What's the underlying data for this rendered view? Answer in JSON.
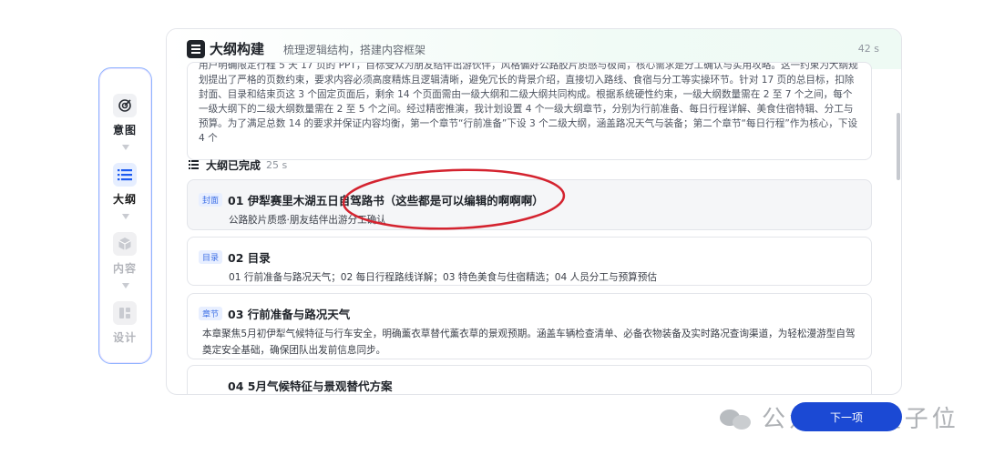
{
  "steps": [
    {
      "label": "意图",
      "icon": "target-icon",
      "state": "done"
    },
    {
      "label": "大纲",
      "icon": "list-icon",
      "state": "active"
    },
    {
      "label": "内容",
      "icon": "cube-icon",
      "state": "pending"
    },
    {
      "label": "设计",
      "icon": "design-icon",
      "state": "pending"
    }
  ],
  "header": {
    "title": "大纲构建",
    "subtitle": "梳理逻辑结构，搭建内容框架",
    "time": "42 s"
  },
  "reasoning": {
    "text": "用户明确限定行程 5 天 17 页的 PPT，目标受众为朋友结伴出游伙伴，风格偏好公路胶片质感与极简，核心需求是分工确认与实用攻略。这一约束为大纲规划提出了严格的页数约束，要求内容必须高度精炼且逻辑清晰，避免冗长的背景介绍，直接切入路线、食宿与分工等实操环节。针对 17 页的总目标，扣除封面、目录和结束页这 3 个固定页面后，剩余 14 个页面需由一级大纲和二级大纲共同构成。根据系统硬性约束，一级大纲数量需在 2 至 7 个之间，每个一级大纲下的二级大纲数量需在 2 至 5 个之间。经过精密推演，我计划设置 4 个一级大纲章节，分别为行前准备、每日行程详解、美食住宿特辑、分工与预算。为了满足总数 14 的要求并保证内容均衡，第一个章节“行前准备”下设 3 个二级大纲，涵盖路况天气与装备；第二个章节“每日行程”作为核心，下设 4 个"
  },
  "done": {
    "label": "大纲已完成",
    "time": "25 s"
  },
  "cards": [
    {
      "tag": "封面",
      "title": "01  伊犁赛里木湖五日自驾路书（这些都是可以编辑的啊啊啊）",
      "desc": "公路胶片质感·朋友结伴出游分工确认"
    },
    {
      "tag": "目录",
      "title": "02  目录",
      "desc": "01 行前准备与路况天气；02 每日行程路线详解；03 特色美食与住宿精选；04 人员分工与预算预估"
    },
    {
      "tag": "章节",
      "title": "03  行前准备与路况天气",
      "desc": "本章聚焦5月初伊犁气候特征与行车安全，明确薰衣草替代薰衣草的景观预期。涵盖车辆检查清单、必备衣物装备及实时路况查询渠道，为轻松漫游型自驾奠定安全基础，确保团队出发前信息同步。"
    },
    {
      "tag": "",
      "title": "04  5月气候特征与景观替代方案",
      "desc": ""
    }
  ],
  "watermark": {
    "text": "公众号 · 量子位"
  },
  "next_button": {
    "label": "下一项"
  },
  "colors": {
    "accent": "#1b49d4",
    "annotation": "#d4232f",
    "rail_border": "#8fb4ff"
  }
}
